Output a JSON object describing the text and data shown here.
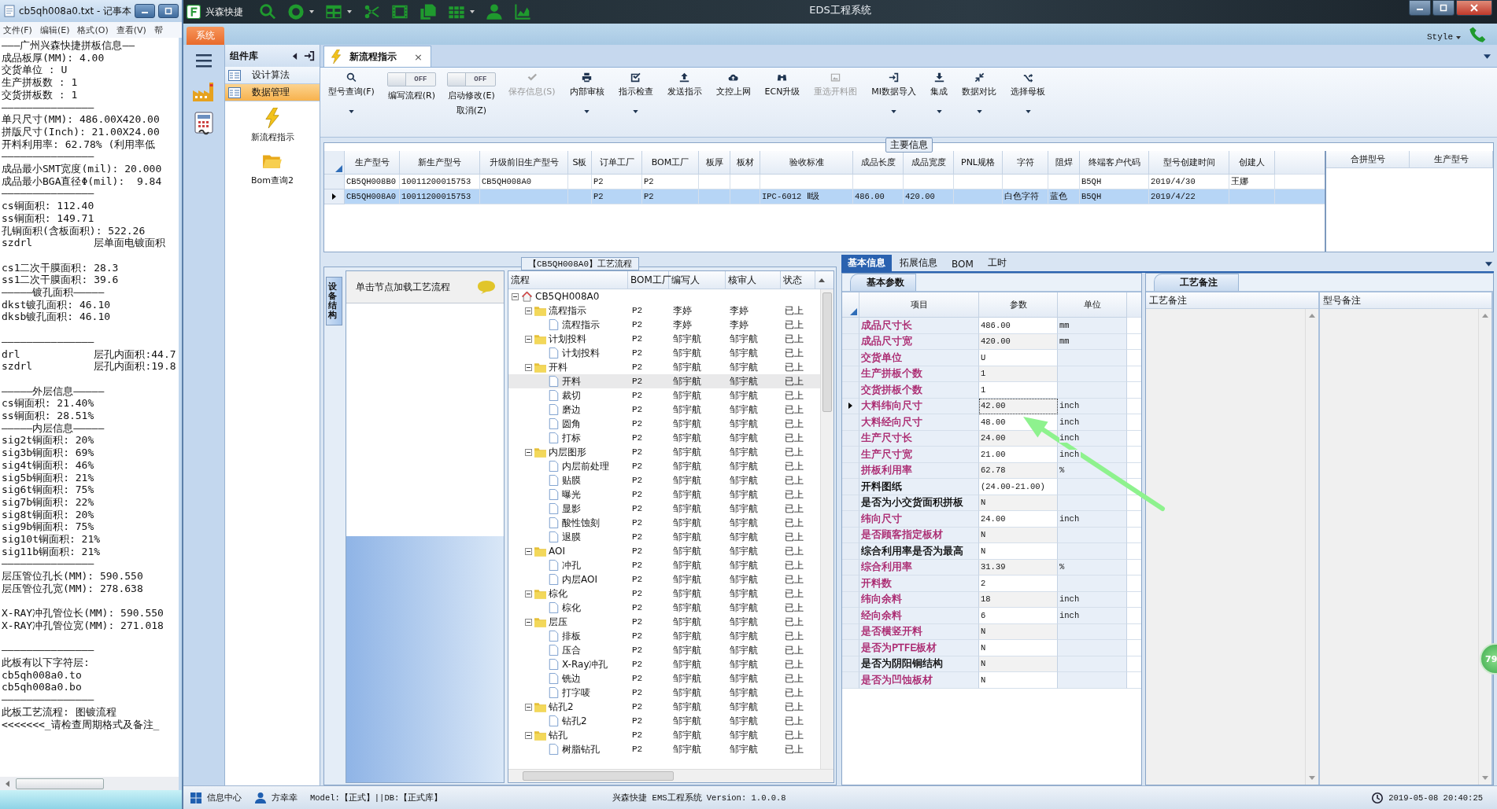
{
  "notepad": {
    "title": "cb5qh008a0.txt - 记事本",
    "menu": [
      "文件(F)",
      "编辑(E)",
      "格式(O)",
      "查看(V)",
      "帮"
    ],
    "paragraphs": [
      [
        "———广州兴森快捷拼板信息——",
        "成品板厚(MM): 4.00",
        "交货单位 : U",
        "生产拼板数 : 1",
        "交货拼板数 : 1",
        "———————————————",
        "单只尺寸(MM): 486.00X420.00",
        "拼版尺寸(Inch): 21.00X24.00",
        "开料利用率: 62.78% (利用率低",
        "———————————————",
        "成品最小SMT宽度(mil): 20.000",
        "成品最小BGA直径Φ(mil):  9.84",
        "———————————————",
        "cs铜面积: 112.40",
        "ss铜面积: 149.71",
        "孔铜面积(含板面积): 522.26",
        "szdrl          层单面电镀面积"
      ],
      [
        "cs1二次干膜面积: 28.3",
        "ss1二次干膜面积: 39.6",
        "—————镀孔面积—————",
        "dkst镀孔面积: 46.10",
        "dksb镀孔面积: 46.10"
      ],
      [
        "———————————————",
        "drl            层孔内面积:44.7",
        "szdrl          层孔内面积:19.8"
      ],
      [
        "—————外层信息—————",
        "cs铜面积: 21.40%",
        "ss铜面积: 28.51%",
        "—————内层信息—————",
        "sig2t铜面积: 20%",
        "sig3b铜面积: 69%",
        "sig4t铜面积: 46%",
        "sig5b铜面积: 21%",
        "sig6t铜面积: 75%",
        "sig7b铜面积: 22%",
        "sig8t铜面积: 20%",
        "sig9b铜面积: 75%",
        "sig10t铜面积: 21%",
        "sig11b铜面积: 21%",
        "———————————————",
        "层压管位孔长(MM): 590.550",
        "层压管位孔宽(MM): 278.638"
      ],
      [
        "X-RAY冲孔管位长(MM): 590.550",
        "X-RAY冲孔管位宽(MM): 271.018"
      ],
      [
        "———————————————",
        "此板有以下字符层:",
        "cb5qh008a0.to",
        "cb5qh008a0.bo",
        "———————————————",
        "此板工艺流程: 图镀流程",
        "<<<<<<<_请检查周期格式及备注_"
      ]
    ]
  },
  "app": {
    "title": "EDS工程系统",
    "brand": "兴森快捷",
    "menu_tab": "系统",
    "style_label": "Style"
  },
  "component_panel": {
    "title": "组件库",
    "items": [
      {
        "label": "设计算法",
        "selected": false
      },
      {
        "label": "数据管理",
        "selected": true
      }
    ],
    "tools": [
      "新流程指示",
      "Bom查询2"
    ]
  },
  "doc_tab": {
    "label": "新流程指示",
    "close": "×"
  },
  "ribbon": [
    {
      "kind": "button",
      "label": "型号查询(F)",
      "disabled": false,
      "dropdown": true
    },
    {
      "kind": "toggle",
      "state_text": "OFF",
      "on": false,
      "label": "编写流程(R)"
    },
    {
      "kind": "toggle",
      "state_text": "OFF",
      "on": false,
      "label": "启动修改(E)",
      "sublabel": "取消(Z)"
    },
    {
      "kind": "button",
      "label": "保存信息(S)",
      "disabled": true,
      "dropdown": false
    },
    {
      "kind": "button",
      "label": "内部审核",
      "disabled": false,
      "dropdown": true
    },
    {
      "kind": "button",
      "label": "指示检查",
      "disabled": false,
      "dropdown": true
    },
    {
      "kind": "button",
      "label": "发送指示",
      "disabled": false,
      "dropdown": false
    },
    {
      "kind": "button",
      "label": "文控上网",
      "disabled": false,
      "dropdown": false
    },
    {
      "kind": "button",
      "label": "ECN升级",
      "disabled": false,
      "dropdown": false
    },
    {
      "kind": "button",
      "label": "重选开料图",
      "disabled": true,
      "dropdown": false
    },
    {
      "kind": "button",
      "label": "MI数据导入",
      "disabled": false,
      "dropdown": true
    },
    {
      "kind": "button",
      "label": "集成",
      "disabled": false,
      "dropdown": true
    },
    {
      "kind": "button",
      "label": "数据对比",
      "disabled": false,
      "dropdown": true
    },
    {
      "kind": "button",
      "label": "选择母板",
      "disabled": false,
      "dropdown": true
    }
  ],
  "main_info": {
    "title": "主要信息",
    "columns": [
      "生产型号",
      "新生产型号",
      "升级前旧生产型号",
      "S板",
      "订单工厂",
      "BOM工厂",
      "板厚",
      "板材",
      "验收标准",
      "成品长度",
      "成品宽度",
      "PNL规格",
      "字符",
      "阻焊",
      "终端客户代码",
      "型号创建时间",
      "创建人"
    ],
    "rows": [
      {
        "selected": false,
        "cells": [
          "CB5QH008B0",
          "10011200015753",
          "CB5QH008A0",
          null,
          "P2",
          "P2",
          null,
          null,
          null,
          null,
          null,
          null,
          null,
          null,
          "B5QH",
          "2019/4/30",
          "王娜"
        ]
      },
      {
        "selected": true,
        "cells": [
          "CB5QH008A0",
          "10011200015753",
          null,
          null,
          "P2",
          "P2",
          null,
          null,
          "IPC-6012 Ⅱ级",
          "486.00",
          "420.00",
          null,
          "白色字符",
          "蓝色",
          "B5QH",
          "2019/4/22",
          null
        ]
      }
    ],
    "side_columns": [
      "合拼型号",
      "生产型号"
    ]
  },
  "process": {
    "title": "【CB5QH008A0】工艺流程",
    "side_tab": "设备结构",
    "hint": "单击节点加载工艺流程",
    "columns": [
      "流程",
      "BOM工厂",
      "编写人",
      "核审人",
      "状态"
    ],
    "tree": {
      "label": "CB5QH008A0",
      "kind": "root",
      "expanded": true,
      "selected": false,
      "children": [
        {
          "label": "流程指示",
          "kind": "folder",
          "expanded": true,
          "selected": false,
          "bom": "P2",
          "writer": "李婷",
          "reviewer": "李婷",
          "status": "已上",
          "children": [
            {
              "label": "流程指示",
              "kind": "step",
              "selected": false,
              "bom": "P2",
              "writer": "李婷",
              "reviewer": "李婷",
              "status": "已上"
            }
          ]
        },
        {
          "label": "计划投料",
          "kind": "folder",
          "expanded": true,
          "selected": false,
          "bom": "P2",
          "writer": "邹宇航",
          "reviewer": "邹宇航",
          "status": "已上",
          "children": [
            {
              "label": "计划投料",
              "kind": "step",
              "selected": false,
              "bom": "P2",
              "writer": "邹宇航",
              "reviewer": "邹宇航",
              "status": "已上"
            }
          ]
        },
        {
          "label": "开料",
          "kind": "folder",
          "expanded": true,
          "selected": false,
          "bom": "P2",
          "writer": "邹宇航",
          "reviewer": "邹宇航",
          "status": "已上",
          "children": [
            {
              "label": "开料",
              "kind": "step",
              "selected": true,
              "bom": "P2",
              "writer": "邹宇航",
              "reviewer": "邹宇航",
              "status": "已上"
            },
            {
              "label": "裁切",
              "kind": "step",
              "selected": false,
              "bom": "P2",
              "writer": "邹宇航",
              "reviewer": "邹宇航",
              "status": "已上"
            },
            {
              "label": "磨边",
              "kind": "step",
              "selected": false,
              "bom": "P2",
              "writer": "邹宇航",
              "reviewer": "邹宇航",
              "status": "已上"
            },
            {
              "label": "圆角",
              "kind": "step",
              "selected": false,
              "bom": "P2",
              "writer": "邹宇航",
              "reviewer": "邹宇航",
              "status": "已上"
            },
            {
              "label": "打标",
              "kind": "step",
              "selected": false,
              "bom": "P2",
              "writer": "邹宇航",
              "reviewer": "邹宇航",
              "status": "已上"
            }
          ]
        },
        {
          "label": "内层图形",
          "kind": "folder",
          "expanded": true,
          "selected": false,
          "bom": "P2",
          "writer": "邹宇航",
          "reviewer": "邹宇航",
          "status": "已上",
          "children": [
            {
              "label": "内层前处理",
              "kind": "step",
              "selected": false,
              "bom": "P2",
              "writer": "邹宇航",
              "reviewer": "邹宇航",
              "status": "已上"
            },
            {
              "label": "贴膜",
              "kind": "step",
              "selected": false,
              "bom": "P2",
              "writer": "邹宇航",
              "reviewer": "邹宇航",
              "status": "已上"
            },
            {
              "label": "曝光",
              "kind": "step",
              "selected": false,
              "bom": "P2",
              "writer": "邹宇航",
              "reviewer": "邹宇航",
              "status": "已上"
            },
            {
              "label": "显影",
              "kind": "step",
              "selected": false,
              "bom": "P2",
              "writer": "邹宇航",
              "reviewer": "邹宇航",
              "status": "已上"
            },
            {
              "label": "酸性蚀刻",
              "kind": "step",
              "selected": false,
              "bom": "P2",
              "writer": "邹宇航",
              "reviewer": "邹宇航",
              "status": "已上"
            },
            {
              "label": "退膜",
              "kind": "step",
              "selected": false,
              "bom": "P2",
              "writer": "邹宇航",
              "reviewer": "邹宇航",
              "status": "已上"
            }
          ]
        },
        {
          "label": "AOI",
          "kind": "folder",
          "expanded": true,
          "selected": false,
          "bom": "P2",
          "writer": "邹宇航",
          "reviewer": "邹宇航",
          "status": "已上",
          "children": [
            {
              "label": "冲孔",
              "kind": "step",
              "selected": false,
              "bom": "P2",
              "writer": "邹宇航",
              "reviewer": "邹宇航",
              "status": "已上"
            },
            {
              "label": "内层AOI",
              "kind": "step",
              "selected": false,
              "bom": "P2",
              "writer": "邹宇航",
              "reviewer": "邹宇航",
              "status": "已上"
            }
          ]
        },
        {
          "label": "棕化",
          "kind": "folder",
          "expanded": true,
          "selected": false,
          "bom": "P2",
          "writer": "邹宇航",
          "reviewer": "邹宇航",
          "status": "已上",
          "children": [
            {
              "label": "棕化",
              "kind": "step",
              "selected": false,
              "bom": "P2",
              "writer": "邹宇航",
              "reviewer": "邹宇航",
              "status": "已上"
            }
          ]
        },
        {
          "label": "层压",
          "kind": "folder",
          "expanded": true,
          "selected": false,
          "bom": "P2",
          "writer": "邹宇航",
          "reviewer": "邹宇航",
          "status": "已上",
          "children": [
            {
              "label": "排板",
              "kind": "step",
              "selected": false,
              "bom": "P2",
              "writer": "邹宇航",
              "reviewer": "邹宇航",
              "status": "已上"
            },
            {
              "label": "压合",
              "kind": "step",
              "selected": false,
              "bom": "P2",
              "writer": "邹宇航",
              "reviewer": "邹宇航",
              "status": "已上"
            },
            {
              "label": "X-Ray冲孔",
              "kind": "step",
              "selected": false,
              "bom": "P2",
              "writer": "邹宇航",
              "reviewer": "邹宇航",
              "status": "已上"
            },
            {
              "label": "铣边",
              "kind": "step",
              "selected": false,
              "bom": "P2",
              "writer": "邹宇航",
              "reviewer": "邹宇航",
              "status": "已上"
            },
            {
              "label": "打字唛",
              "kind": "step",
              "selected": false,
              "bom": "P2",
              "writer": "邹宇航",
              "reviewer": "邹宇航",
              "status": "已上"
            }
          ]
        },
        {
          "label": "钻孔2",
          "kind": "folder",
          "expanded": true,
          "selected": false,
          "bom": "P2",
          "writer": "邹宇航",
          "reviewer": "邹宇航",
          "status": "已上",
          "children": [
            {
              "label": "钻孔2",
              "kind": "step",
              "selected": false,
              "bom": "P2",
              "writer": "邹宇航",
              "reviewer": "邹宇航",
              "status": "已上"
            }
          ]
        },
        {
          "label": "钻孔",
          "kind": "folder",
          "expanded": true,
          "selected": false,
          "bom": "P2",
          "writer": "邹宇航",
          "reviewer": "邹宇航",
          "status": "已上",
          "children": [
            {
              "label": "树脂钻孔",
              "kind": "step",
              "selected": false,
              "bom": "P2",
              "writer": "邹宇航",
              "reviewer": "邹宇航",
              "status": "已上"
            }
          ]
        }
      ]
    }
  },
  "basic": {
    "tabs": [
      {
        "label": "基本信息",
        "selected": true
      },
      {
        "label": "拓展信息",
        "selected": false
      },
      {
        "label": "BOM",
        "selected": false
      },
      {
        "label": "工时",
        "selected": false
      }
    ],
    "subtab": "基本参数",
    "columns": [
      "项目",
      "参数",
      "单位"
    ],
    "rows": [
      {
        "item": "成品尺寸长",
        "value": "486.00",
        "unit": "mm",
        "color": "#a8206a",
        "selected": false
      },
      {
        "item": "成品尺寸宽",
        "value": "420.00",
        "unit": "mm",
        "color": "#a8206a",
        "selected": false
      },
      {
        "item": "交货单位",
        "value": "U",
        "color": "#a8206a",
        "selected": false
      },
      {
        "item": "生产拼板个数",
        "value": "1",
        "color": "#a8206a",
        "selected": false
      },
      {
        "item": "交货拼板个数",
        "value": "1",
        "color": "#a8206a",
        "selected": false
      },
      {
        "item": "大料纬向尺寸",
        "value": "42.00",
        "unit": "inch",
        "color": "#a8206a",
        "selected": true
      },
      {
        "item": "大料经向尺寸",
        "value": "48.00",
        "unit": "inch",
        "color": "#a8206a",
        "selected": false
      },
      {
        "item": "生产尺寸长",
        "value": "24.00",
        "unit": "inch",
        "color": "#a8206a",
        "selected": false
      },
      {
        "item": "生产尺寸宽",
        "value": "21.00",
        "unit": "inch",
        "color": "#a8206a",
        "selected": false
      },
      {
        "item": "拼板利用率",
        "value": "62.78",
        "unit": "%",
        "color": "#a8206a",
        "selected": false
      },
      {
        "item": "开料图纸",
        "value": "(24.00-21.00)",
        "color": "#000000",
        "selected": false
      },
      {
        "item": "是否为小交货面积拼板",
        "value": "N",
        "color": "#000000",
        "selected": false
      },
      {
        "item": "纬向尺寸",
        "value": "24.00",
        "unit": "inch",
        "color": "#a8206a",
        "selected": false
      },
      {
        "item": "是否顾客指定板材",
        "value": "N",
        "color": "#a8206a",
        "selected": false
      },
      {
        "item": "综合利用率是否为最高",
        "value": "N",
        "color": "#000000",
        "selected": false
      },
      {
        "item": "综合利用率",
        "value": "31.39",
        "unit": "%",
        "color": "#a8206a",
        "selected": false
      },
      {
        "item": "开料数",
        "value": "2",
        "color": "#a8206a",
        "selected": false
      },
      {
        "item": "纬向余料",
        "value": "18",
        "unit": "inch",
        "color": "#a8206a",
        "selected": false
      },
      {
        "item": "经向余料",
        "value": "6",
        "unit": "inch",
        "color": "#a8206a",
        "selected": false
      },
      {
        "item": "是否横竖开料",
        "value": "N",
        "color": "#a8206a",
        "selected": false
      },
      {
        "item": "是否为PTFE板材",
        "value": "N",
        "color": "#a8206a",
        "selected": false
      },
      {
        "item": "是否为阴阳铜结构",
        "value": "N",
        "color": "#000000",
        "selected": false
      },
      {
        "item": "是否为凹蚀板材",
        "value": "N",
        "color": "#a8206a",
        "selected": false
      }
    ]
  },
  "remarks": {
    "tab": "工艺备注",
    "columns": [
      "工艺备注",
      "型号备注"
    ]
  },
  "floating_badge": "79",
  "status_bar": {
    "info": "信息中心",
    "user": "方幸幸",
    "model": "Model:【正式】||DB:【正式库】",
    "version": "兴森快捷 EMS工程系统 Version: 1.0.0.8",
    "datetime": "2019-05-08 20:40:25"
  }
}
